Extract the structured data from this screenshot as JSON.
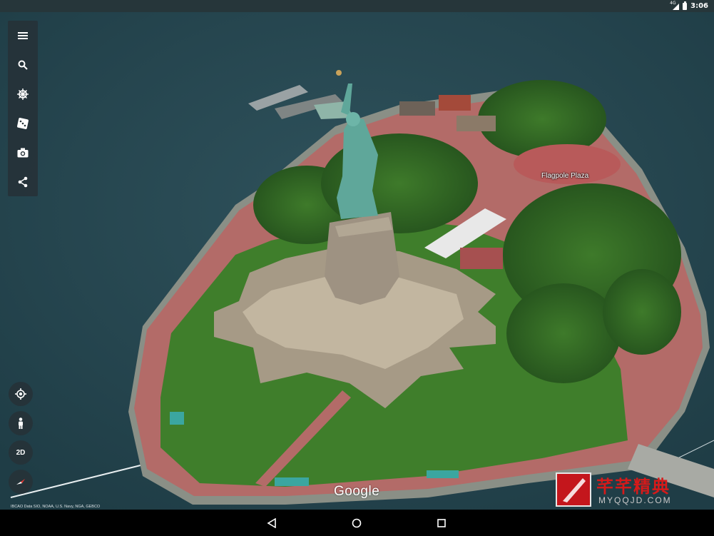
{
  "status_bar": {
    "network_badge": "4G",
    "clock": "3:06"
  },
  "toolbar": {
    "items": [
      {
        "icon": "menu-icon"
      },
      {
        "icon": "search-icon"
      },
      {
        "icon": "voyager-wheel-icon"
      },
      {
        "icon": "feeling-lucky-dice-icon"
      },
      {
        "icon": "camera-icon"
      },
      {
        "icon": "share-icon"
      }
    ]
  },
  "map": {
    "place_label": "Flagpole Plaza",
    "view_toggle_label": "2D",
    "logo": "Google",
    "attribution": "IBCAO Data SIO, NOAA, U.S. Navy, NGA, GEBCO"
  },
  "watermark": {
    "chinese": "芊芊精典",
    "url": "MYQQJD.COM"
  },
  "colors": {
    "water": "#2a4b55",
    "grass": "#3d7a2a",
    "path": "#b86a6a",
    "toolbar_bg": "#263238",
    "watermark_red": "#c4161c"
  }
}
